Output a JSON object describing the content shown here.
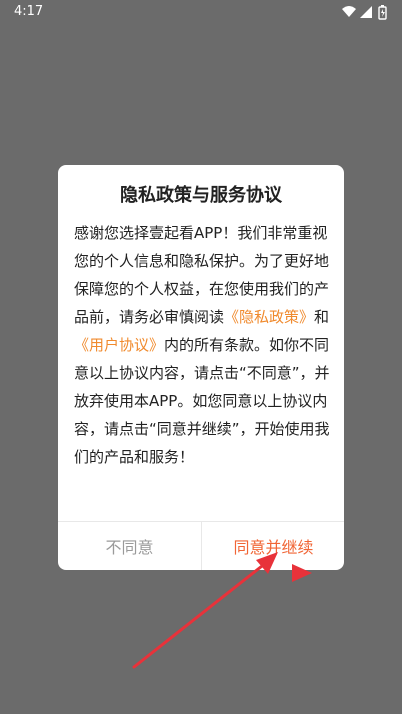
{
  "status_bar": {
    "time": "4:17"
  },
  "dialog": {
    "title": "隐私政策与服务协议",
    "body": {
      "text_before": "感谢您选择壹起看APP！我们非常重视您的个人信息和隐私保护。为了更好地保障您的个人权益，在您使用我们的产品前，请务必审慎阅读",
      "privacy_link": "《隐私政策》",
      "connector": "和",
      "agreement_link": "《用户协议》",
      "text_after": "内的所有条款。如你不同意以上协议内容，请点击“不同意”，并放弃使用本APP。如您同意以上协议内容，请点击“同意并继续”，开始使用我们的产品和服务！"
    },
    "buttons": {
      "decline": "不同意",
      "accept": "同意并继续"
    }
  },
  "colors": {
    "overlay": "#6b6b6b",
    "link": "#f08a2d",
    "accept": "#f16535",
    "annotation_arrow": "#e8323a"
  },
  "icons": [
    "wifi-icon",
    "signal-icon",
    "battery-icon"
  ]
}
